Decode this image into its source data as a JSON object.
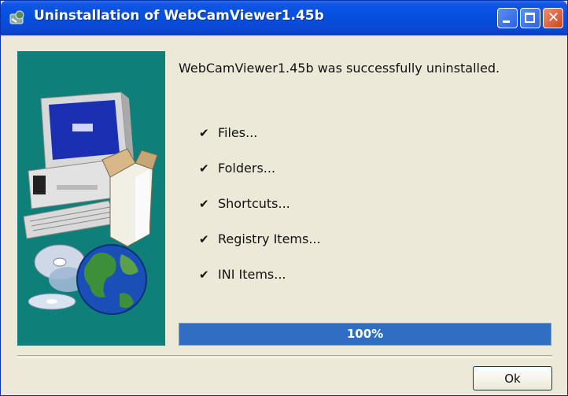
{
  "window": {
    "title": "Uninstallation of WebCamViewer1.45b",
    "close_glyph": "✕"
  },
  "message": "WebCamViewer1.45b was successfully uninstalled.",
  "checklist": [
    {
      "label": "Files...",
      "checked": true
    },
    {
      "label": "Folders...",
      "checked": true
    },
    {
      "label": "Shortcuts...",
      "checked": true
    },
    {
      "label": "Registry Items...",
      "checked": true
    },
    {
      "label": "INI Items...",
      "checked": true
    }
  ],
  "check_glyph": "✔",
  "progress": {
    "value": 1.0,
    "label": "100%"
  },
  "ok_button": {
    "label": "Ok"
  },
  "colors": {
    "titlebar": "#0550e0",
    "panel": "#0e7f79",
    "progress_fill": "#2f6ec2",
    "window_bg": "#ece9d8"
  },
  "icons": {
    "title": "installer-icon",
    "side": "computer-cd-globe-illustration"
  }
}
